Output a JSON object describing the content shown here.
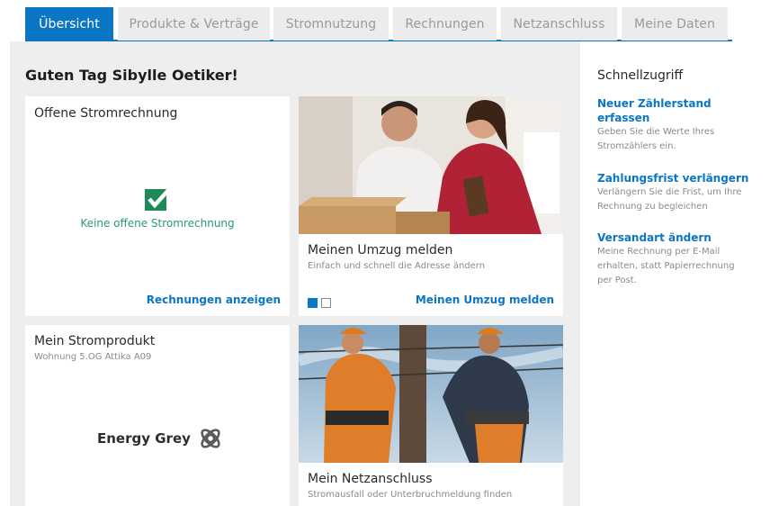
{
  "tabs": [
    {
      "label": "Übersicht",
      "active": true
    },
    {
      "label": "Produkte & Verträge",
      "active": false
    },
    {
      "label": "Stromnutzung",
      "active": false
    },
    {
      "label": "Rechnungen",
      "active": false
    },
    {
      "label": "Netzanschluss",
      "active": false
    },
    {
      "label": "Meine Daten",
      "active": false
    }
  ],
  "greeting": "Guten Tag Sibylle Oetiker!",
  "cards": {
    "bill": {
      "title": "Offene Stromrechnung",
      "status": "Keine offene Stromrechnung",
      "link": "Rechnungen anzeigen"
    },
    "move": {
      "title": "Meinen Umzug melden",
      "subtitle": "Einfach und schnell die Adresse ändern",
      "link": "Meinen Umzug melden"
    },
    "product": {
      "title": "Mein Stromprodukt",
      "subtitle": "Wohnung 5.OG Attika A09",
      "brand": "Energy Grey"
    },
    "grid": {
      "title": "Mein Netzanschluss",
      "subtitle": "Stromausfall oder Unterbruchmeldung finden"
    }
  },
  "sidebar": {
    "title": "Schnellzugriff",
    "items": [
      {
        "link": "Neuer Zählerstand erfassen",
        "desc": "Geben Sie die Werte Ihres Stromzählers ein."
      },
      {
        "link": "Zahlungsfrist verlängern",
        "desc": "Verlängern Sie die Frist, um Ihre Rechnung zu begleichen"
      },
      {
        "link": "Versandart ändern",
        "desc": "Meine Rechnung per E-Mail erhalten, statt Papierrechnung per Post."
      }
    ]
  },
  "colors": {
    "accent": "#0b76c5",
    "success": "#2a9a6a",
    "check": "#1e8a5a"
  }
}
